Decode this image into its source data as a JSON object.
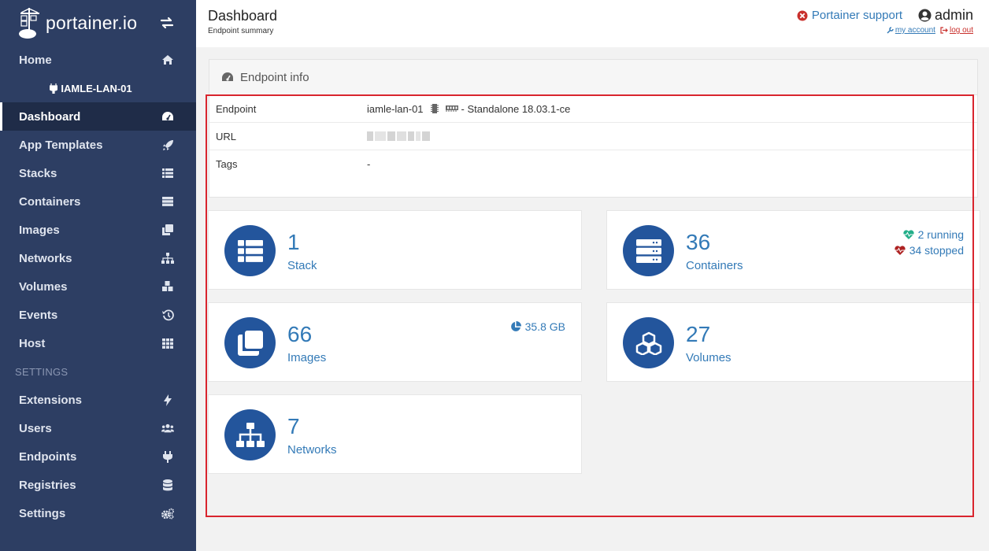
{
  "brand": {
    "name": "portainer.io"
  },
  "sidebar": {
    "home": "Home",
    "endpoint": "IAMLE-LAN-01",
    "items": [
      {
        "label": "Dashboard",
        "icon": "tachometer-icon"
      },
      {
        "label": "App Templates",
        "icon": "rocket-icon"
      },
      {
        "label": "Stacks",
        "icon": "th-list-icon"
      },
      {
        "label": "Containers",
        "icon": "server-icon"
      },
      {
        "label": "Images",
        "icon": "clone-icon"
      },
      {
        "label": "Networks",
        "icon": "sitemap-icon"
      },
      {
        "label": "Volumes",
        "icon": "cubes-icon"
      },
      {
        "label": "Events",
        "icon": "history-icon"
      },
      {
        "label": "Host",
        "icon": "th-icon"
      }
    ],
    "settings_heading": "SETTINGS",
    "settings_items": [
      {
        "label": "Extensions",
        "icon": "bolt-icon"
      },
      {
        "label": "Users",
        "icon": "users-icon"
      },
      {
        "label": "Endpoints",
        "icon": "plug-icon"
      },
      {
        "label": "Registries",
        "icon": "database-icon"
      },
      {
        "label": "Settings",
        "icon": "cogs-icon"
      }
    ]
  },
  "header": {
    "title": "Dashboard",
    "subtitle": "Endpoint summary",
    "support": "Portainer support",
    "user": "admin",
    "my_account": "my account",
    "log_out": "log out"
  },
  "endpoint_info": {
    "title": "Endpoint info",
    "rows": [
      {
        "key": "Endpoint",
        "value": "iamle-lan-01",
        "suffix": "- Standalone 18.03.1-ce"
      },
      {
        "key": "URL",
        "value": ""
      },
      {
        "key": "Tags",
        "value": "-"
      }
    ]
  },
  "tiles": {
    "stack": {
      "count": "1",
      "label": "Stack"
    },
    "containers": {
      "count": "36",
      "label": "Containers",
      "running": "2 running",
      "stopped": "34 stopped"
    },
    "images": {
      "count": "66",
      "label": "Images",
      "size": "35.8 GB"
    },
    "volumes": {
      "count": "27",
      "label": "Volumes"
    },
    "networks": {
      "count": "7",
      "label": "Networks"
    }
  },
  "colors": {
    "sidebar": "#2d3e63",
    "accent": "#337ab7",
    "tile_circle": "#23559c",
    "running": "#23ae89",
    "stopped": "#ae2323",
    "highlight": "#d9252e"
  }
}
